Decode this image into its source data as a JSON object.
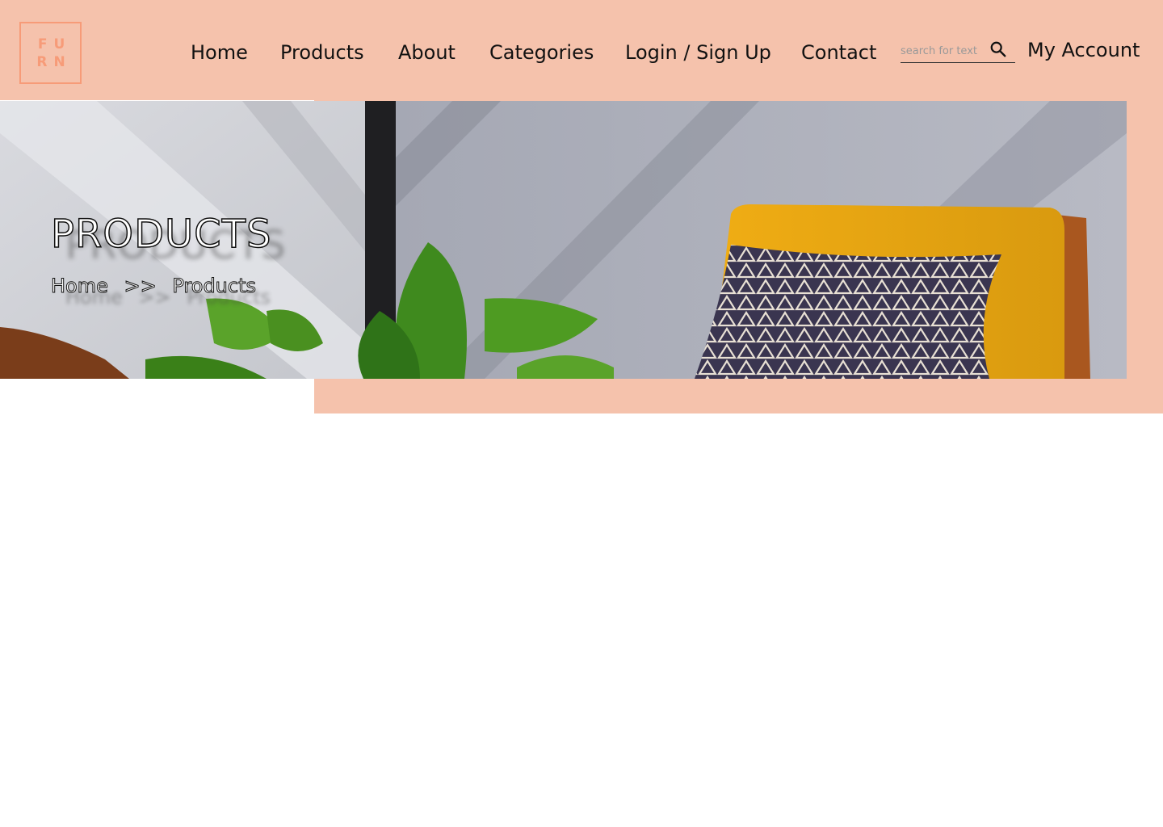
{
  "logo": {
    "letters": [
      "F",
      "U",
      "R",
      "N"
    ]
  },
  "nav": {
    "items": [
      {
        "label": "Home"
      },
      {
        "label": "Products"
      },
      {
        "label": "About"
      },
      {
        "label": "Categories"
      },
      {
        "label": "Login / Sign Up"
      },
      {
        "label": "Contact"
      }
    ]
  },
  "search": {
    "placeholder": "search for text",
    "value": ""
  },
  "account": {
    "label": "My Account"
  },
  "banner": {
    "title": "PRODUCTS",
    "breadcrumb": {
      "home": "Home",
      "separator": ">>",
      "current": "Products"
    }
  },
  "colors": {
    "header_bg": "#f5c2ac",
    "logo_accent": "#f79b78",
    "chair": "#e9a414"
  }
}
